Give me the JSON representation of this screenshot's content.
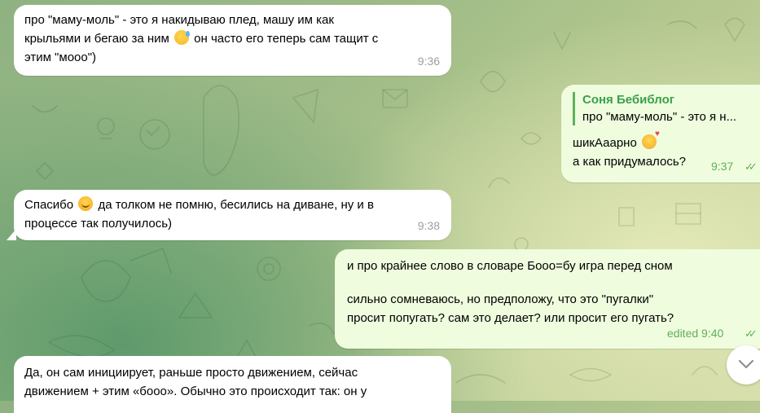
{
  "messages": [
    {
      "id": "m1",
      "direction": "incoming",
      "lines": [
        "про \"маму-моль\" - это я накидываю плед, машу им как",
        "крыльями и бегаю за ним",
        "он часто его теперь сам тащит с",
        "этим \"мооо\")"
      ],
      "emoji": "grinning-sweat-emoji",
      "time": "9:36"
    },
    {
      "id": "m2",
      "direction": "outgoing",
      "reply": {
        "author": "Соня Бебиблог",
        "text": "про \"маму-моль\" - это я н..."
      },
      "lines": [
        "шикАаарно",
        "а как придумалось?"
      ],
      "emoji": "smiling-hearts-emoji",
      "time": "9:37",
      "status": "read"
    },
    {
      "id": "m3",
      "direction": "incoming",
      "lines": [
        "Спасибо",
        "да толком не помню, бесились на диване, ну и в",
        "процессе так получилось)"
      ],
      "emoji": "smiling-emoji",
      "time": "9:38"
    },
    {
      "id": "m4",
      "direction": "outgoing",
      "lines": [
        "и про крайнее слово в словаре Бооо=бу игра перед сном",
        "",
        "сильно сомневаюсь, но предположу, что это \"пугалки\"",
        "просит попугать? сам это делает? или просит его пугать?"
      ],
      "time": "edited 9:40",
      "status": "read"
    },
    {
      "id": "m5",
      "direction": "incoming",
      "lines": [
        "Да, он сам инициирует, раньше просто движением, сейчас",
        "движением + этим «бооо». Обычно это происходит так: он у"
      ]
    }
  ],
  "colors": {
    "incoming_bubble": "#ffffff",
    "outgoing_bubble": "#effdde",
    "outgoing_meta": "#5fae5a",
    "reply_accent": "#3aa04b"
  },
  "icons": {
    "scroll_down": "chevron-down-icon",
    "read_status": "double-check-icon"
  }
}
